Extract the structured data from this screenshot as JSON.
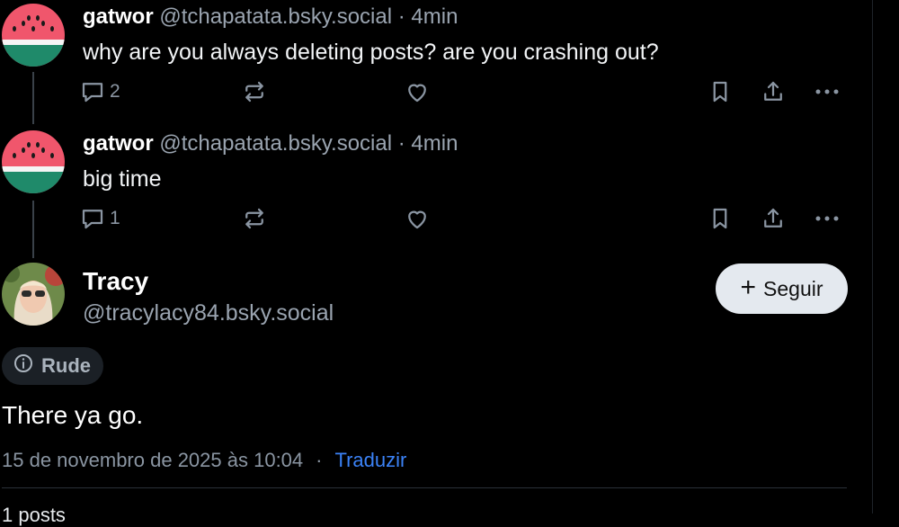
{
  "posts": [
    {
      "name": "gatwor",
      "handle": "@tchapatata.bsky.social",
      "time": "· 4min",
      "text": "why are you always deleting posts? are you crashing out?",
      "reply_count": "2"
    },
    {
      "name": "gatwor",
      "handle": "@tchapatata.bsky.social",
      "time": "· 4min",
      "text": "big time",
      "reply_count": "1"
    }
  ],
  "main_post": {
    "name": "Tracy",
    "handle": "@tracylacy84.bsky.social",
    "follow_label": "Seguir",
    "label": "Rude",
    "text": "There ya go.",
    "date": "15 de novembro de 2025 às 10:04",
    "separator": "·",
    "translate": "Traduzir",
    "stats": "1 posts"
  },
  "icons": {
    "reply": "reply-icon",
    "repost": "repost-icon",
    "like": "heart-icon",
    "bookmark": "bookmark-icon",
    "share": "share-icon",
    "more": "more-icon",
    "info": "info-icon"
  },
  "colors": {
    "background": "#000000",
    "follow_button": "#e4e9ef",
    "link": "#3b82f6",
    "muted": "#8a95a2"
  }
}
